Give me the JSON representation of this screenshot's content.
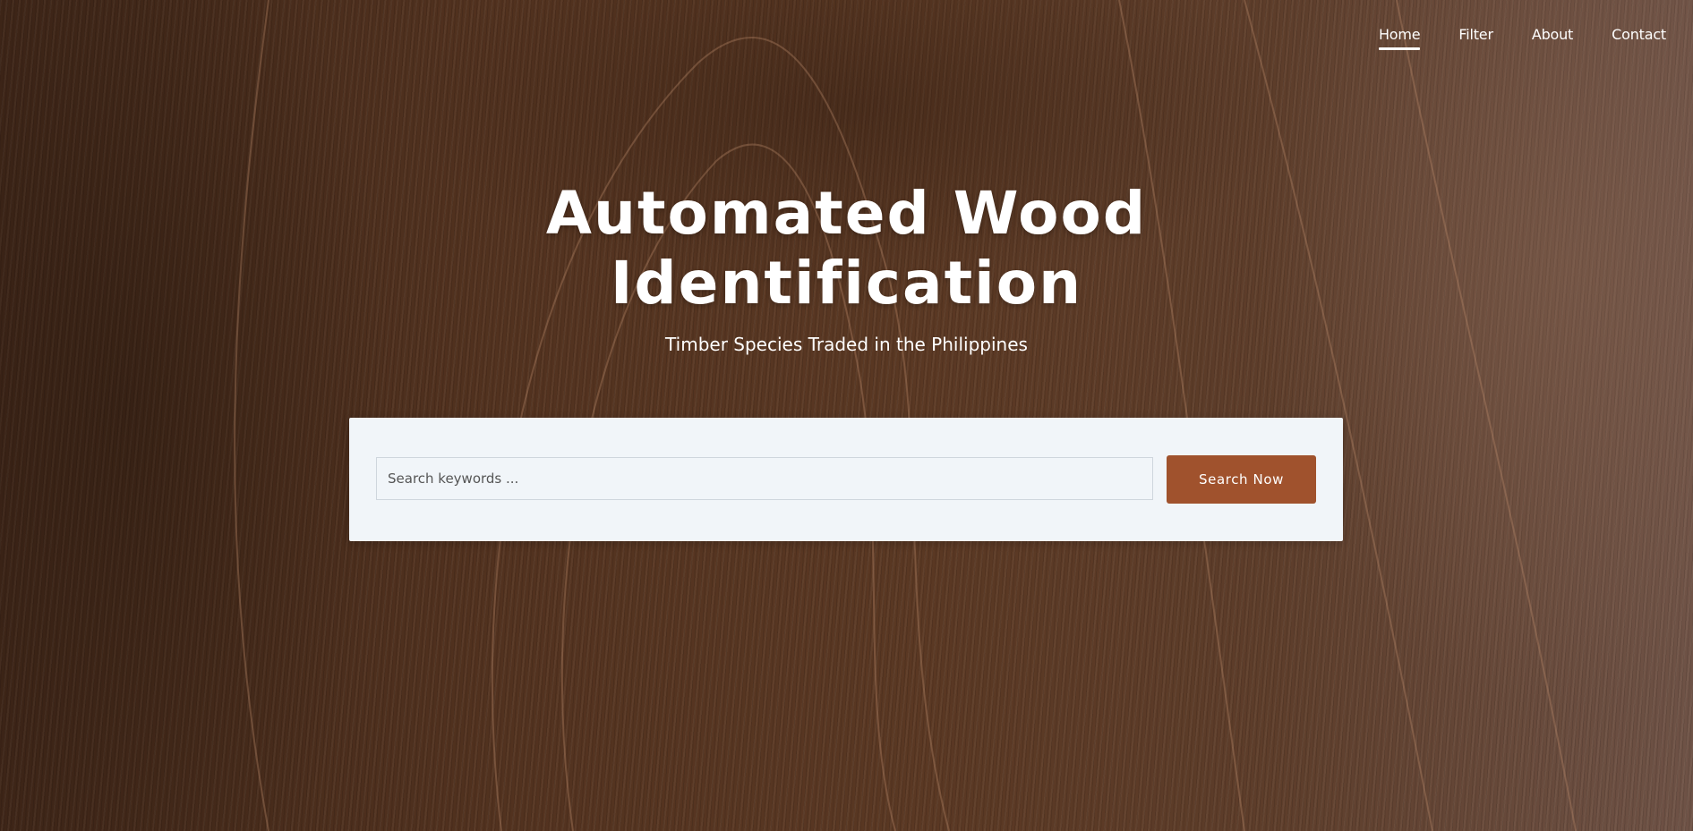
{
  "nav": {
    "items": [
      {
        "label": "Home",
        "active": true
      },
      {
        "label": "Filter",
        "active": false
      },
      {
        "label": "About",
        "active": false
      },
      {
        "label": "Contact",
        "active": false
      }
    ]
  },
  "hero": {
    "title_line1": "Automated Wood",
    "title_line2": "Identification",
    "subtitle": "Timber Species Traded in the Philippines"
  },
  "search": {
    "placeholder": "Search keywords ...",
    "value": "",
    "button_label": "Search Now"
  },
  "colors": {
    "accent": "#a0522d",
    "panel_background": "#f1f5f9",
    "text_on_hero": "#ffffff"
  }
}
